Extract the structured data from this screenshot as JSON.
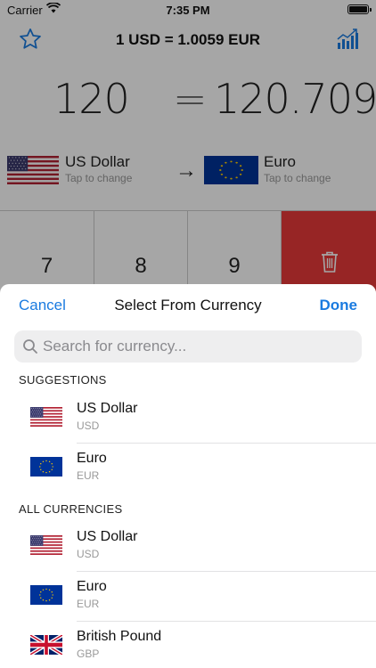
{
  "status_bar": {
    "carrier": "Carrier",
    "time": "7:35 PM"
  },
  "nav": {
    "rate": "1 USD = 1.0059 EUR"
  },
  "converter": {
    "from_amount": "120",
    "equals": "=",
    "to_amount": "120.709",
    "from": {
      "name": "US Dollar",
      "hint": "Tap to change"
    },
    "to": {
      "name": "Euro",
      "hint": "Tap to change"
    },
    "arrow": "→"
  },
  "keypad": {
    "keys": [
      "7",
      "8",
      "9"
    ]
  },
  "sheet": {
    "cancel": "Cancel",
    "title": "Select From Currency",
    "done": "Done",
    "search_placeholder": "Search for currency...",
    "suggestions_header": "SUGGESTIONS",
    "suggestions": [
      {
        "name": "US Dollar",
        "code": "USD"
      },
      {
        "name": "Euro",
        "code": "EUR"
      }
    ],
    "all_header": "ALL CURRENCIES",
    "all": [
      {
        "name": "US Dollar",
        "code": "USD"
      },
      {
        "name": "Euro",
        "code": "EUR"
      },
      {
        "name": "British Pound",
        "code": "GBP"
      }
    ]
  },
  "colors": {
    "accent": "#1a7be0",
    "delete_key": "#e83a3a",
    "us_red": "#b22234",
    "us_blue": "#3c3b6e",
    "eu_blue": "#003399",
    "eu_star": "#ffcc00",
    "uk_blue": "#012169",
    "uk_red": "#c8102e"
  },
  "icons": {
    "favorite": "star-icon",
    "history": "chart-icon",
    "delete": "trash-icon",
    "search": "magnifier-icon"
  }
}
